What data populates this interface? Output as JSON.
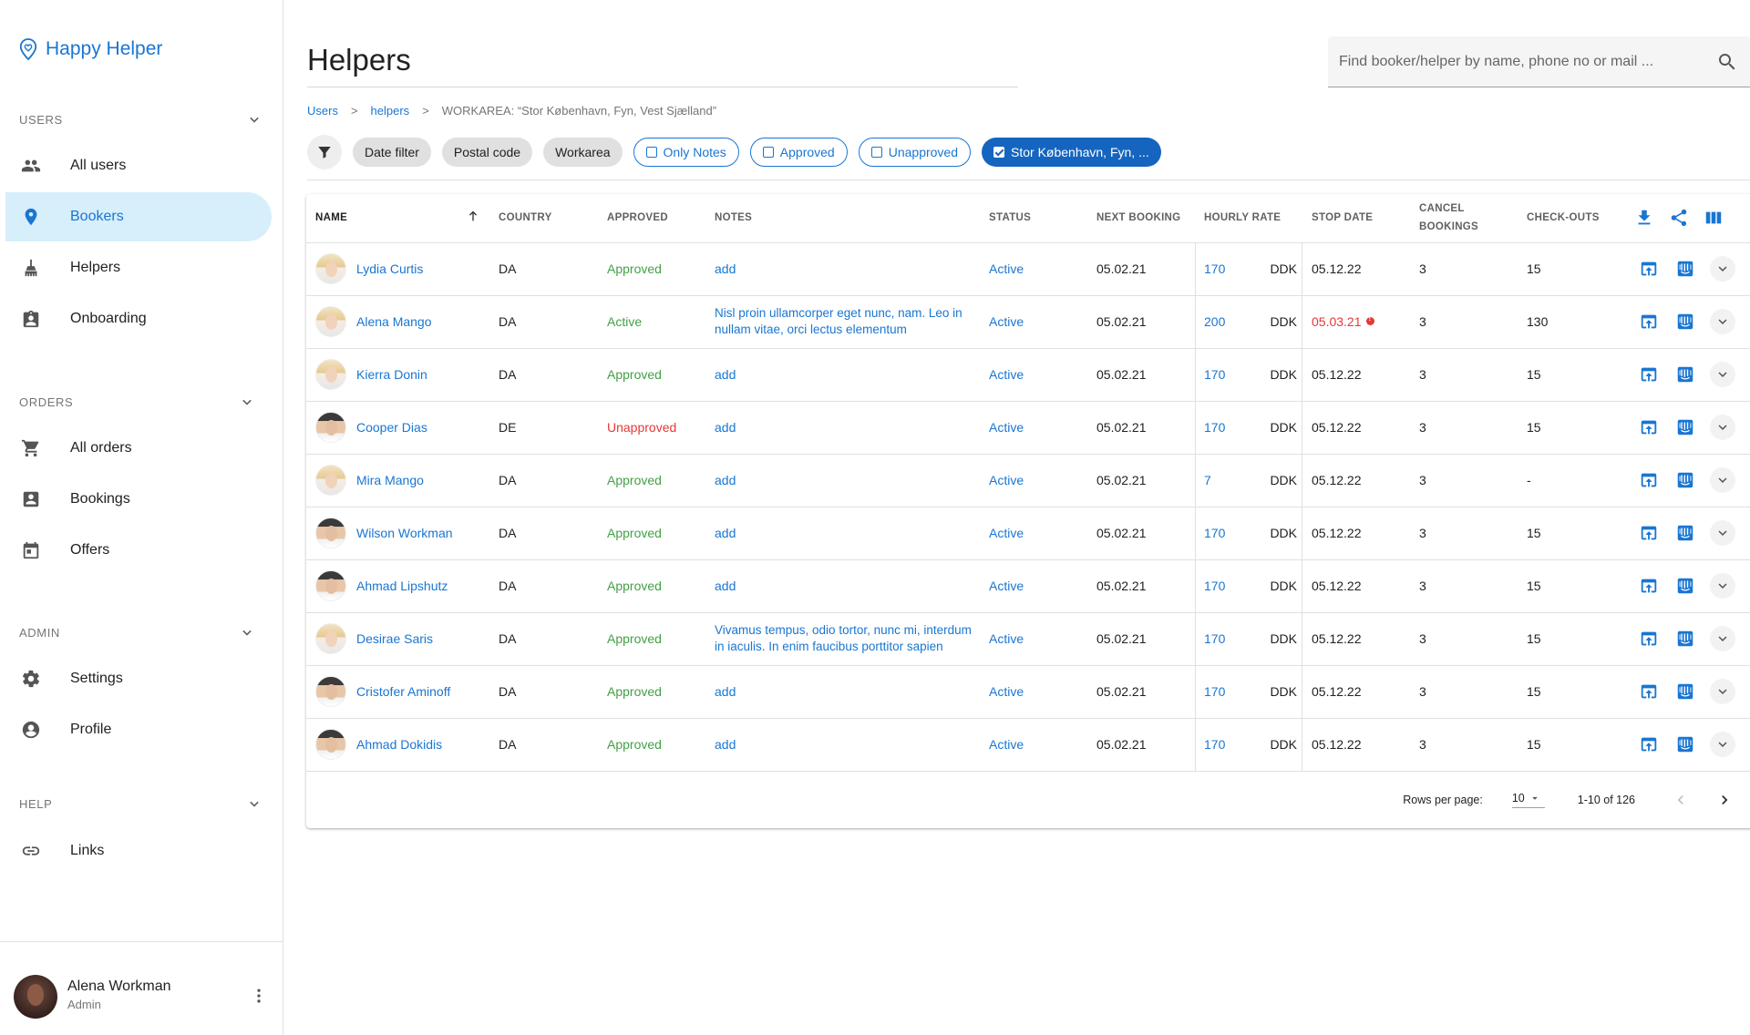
{
  "app": {
    "logo_text": "Happy Helper"
  },
  "sidebar": {
    "sections": [
      {
        "title": "USERS",
        "items": [
          "All users",
          "Bookers",
          "Helpers",
          "Onboarding"
        ]
      },
      {
        "title": "ORDERS",
        "items": [
          "All orders",
          "Bookings",
          "Offers"
        ]
      },
      {
        "title": "ADMIN",
        "items": [
          "Settings",
          "Profile"
        ]
      },
      {
        "title": "HELP",
        "items": [
          "Links"
        ]
      }
    ],
    "active_item": "Bookers"
  },
  "user": {
    "name": "Alena Workman",
    "role": "Admin"
  },
  "page": {
    "title": "Helpers"
  },
  "search": {
    "placeholder": "Find booker/helper by name, phone no or mail ..."
  },
  "breadcrumb": {
    "root": "Users",
    "level1": "helpers",
    "current": "WORKAREA: “Stor København, Fyn, Vest Sjælland”",
    "separator": ">"
  },
  "filters": {
    "chips": [
      "Date filter",
      "Postal code",
      "Workarea"
    ],
    "toggles": [
      "Only Notes",
      "Approved",
      "Unapproved"
    ],
    "active": "Stor København, Fyn, ..."
  },
  "table": {
    "headers": {
      "name": "NAME",
      "country": "COUNTRY",
      "approved": "APPROVED",
      "notes": "NOTES",
      "status": "STATUS",
      "next_booking": "NEXT BOOKING",
      "hourly_rate": "HOURLY RATE",
      "stop_date": "STOP DATE",
      "cancel_line1": "CANCEL",
      "cancel_line2": "BOOKINGS",
      "checkouts": "CHECK-OUTS"
    },
    "currency": "DDK",
    "rows": [
      {
        "name": "Lydia Curtis",
        "avatar": "female",
        "country": "DA",
        "approved": "Approved",
        "approved_state": "ok",
        "note": "add",
        "status": "Active",
        "next_booking": "05.02.21",
        "rate": "170",
        "stop_date": "05.12.22",
        "stop_alert": false,
        "cancel": "3",
        "checkouts": "15"
      },
      {
        "name": "Alena Mango",
        "avatar": "female",
        "country": "DA",
        "approved": "Active",
        "approved_state": "ok",
        "note": "Nisl proin ullamcorper eget nunc, nam. Leo in nullam vitae, orci lectus elementum",
        "status": "Active",
        "next_booking": "05.02.21",
        "rate": "200",
        "stop_date": "05.03.21",
        "stop_alert": true,
        "cancel": "3",
        "checkouts": "130"
      },
      {
        "name": "Kierra Donin",
        "avatar": "female",
        "country": "DA",
        "approved": "Approved",
        "approved_state": "ok",
        "note": "add",
        "status": "Active",
        "next_booking": "05.02.21",
        "rate": "170",
        "stop_date": "05.12.22",
        "stop_alert": false,
        "cancel": "3",
        "checkouts": "15"
      },
      {
        "name": "Cooper Dias",
        "avatar": "male",
        "country": "DE",
        "approved": "Unapproved",
        "approved_state": "bad",
        "note": "add",
        "status": "Active",
        "next_booking": "05.02.21",
        "rate": "170",
        "stop_date": "05.12.22",
        "stop_alert": false,
        "cancel": "3",
        "checkouts": "15"
      },
      {
        "name": "Mira Mango",
        "avatar": "female",
        "country": "DA",
        "approved": "Approved",
        "approved_state": "ok",
        "note": "add",
        "status": "Active",
        "next_booking": "05.02.21",
        "rate": "7",
        "stop_date": "05.12.22",
        "stop_alert": false,
        "cancel": "3",
        "checkouts": "-"
      },
      {
        "name": "Wilson Workman",
        "avatar": "male",
        "country": "DA",
        "approved": "Approved",
        "approved_state": "ok",
        "note": "add",
        "status": "Active",
        "next_booking": "05.02.21",
        "rate": "170",
        "stop_date": "05.12.22",
        "stop_alert": false,
        "cancel": "3",
        "checkouts": "15"
      },
      {
        "name": "Ahmad Lipshutz",
        "avatar": "male",
        "country": "DA",
        "approved": "Approved",
        "approved_state": "ok",
        "note": "add",
        "status": "Active",
        "next_booking": "05.02.21",
        "rate": "170",
        "stop_date": "05.12.22",
        "stop_alert": false,
        "cancel": "3",
        "checkouts": "15"
      },
      {
        "name": "Desirae Saris",
        "avatar": "female",
        "country": "DA",
        "approved": "Approved",
        "approved_state": "ok",
        "note": "Vivamus tempus, odio tortor, nunc mi, interdum in iaculis. In enim faucibus porttitor sapien",
        "status": "Active",
        "next_booking": "05.02.21",
        "rate": "170",
        "stop_date": "05.12.22",
        "stop_alert": false,
        "cancel": "3",
        "checkouts": "15"
      },
      {
        "name": "Cristofer Aminoff",
        "avatar": "male",
        "country": "DA",
        "approved": "Approved",
        "approved_state": "ok",
        "note": "add",
        "status": "Active",
        "next_booking": "05.02.21",
        "rate": "170",
        "stop_date": "05.12.22",
        "stop_alert": false,
        "cancel": "3",
        "checkouts": "15"
      },
      {
        "name": "Ahmad Dokidis",
        "avatar": "male",
        "country": "DA",
        "approved": "Approved",
        "approved_state": "ok",
        "note": "add",
        "status": "Active",
        "next_booking": "05.02.21",
        "rate": "170",
        "stop_date": "05.12.22",
        "stop_alert": false,
        "cancel": "3",
        "checkouts": "15"
      }
    ]
  },
  "pagination": {
    "rows_per_page_label": "Rows per page:",
    "rows_per_page": "10",
    "range": "1-10 of 126"
  },
  "colors": {
    "primary": "#1976d2",
    "active_nav_bg": "#d7eefb",
    "approved": "#43a047",
    "unapproved": "#e53935"
  },
  "icons": {
    "nav": [
      "people-icon",
      "location-pin-icon",
      "broom-icon",
      "badge-icon",
      "cart-icon",
      "contact-card-icon",
      "calendar-icon",
      "gear-icon",
      "account-circle-icon",
      "link-icon"
    ]
  }
}
